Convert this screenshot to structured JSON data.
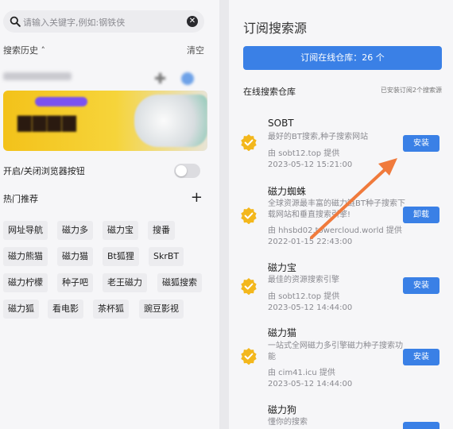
{
  "search": {
    "placeholder": "请输入关键字,例如:钢铁侠",
    "clear_icon": "close-circle-icon"
  },
  "history": {
    "label": "搜索历史 ˄",
    "clear": "清空"
  },
  "browser_toggle": {
    "label": "开启/关闭浏览器按钮"
  },
  "hot": {
    "label": "热门推荐",
    "chips": [
      "网址导航",
      "磁力多",
      "磁力宝",
      "搜番",
      "磁力熊猫",
      "磁力猫",
      "Bt狐狸",
      "SkrBT",
      "磁力柠檬",
      "种子吧",
      "老王磁力",
      "磁狐搜索",
      "磁力狐",
      "看电影",
      "茶杯狐",
      "豌豆影视"
    ]
  },
  "right": {
    "title": "订阅搜索源",
    "subscribe_button": "订阅在线仓库：26 个",
    "repo_label": "在线搜索仓库",
    "installed_note": "已安装订阅2个搜索源",
    "items": [
      {
        "name": "SOBT",
        "desc": "最好的BT搜索,种子搜索网站",
        "provider": "由 sobt12.top 提供",
        "date": "2023-05-12 15:21:00",
        "action": "安装"
      },
      {
        "name": "磁力蜘蛛",
        "desc": "全球资源最丰富的磁力链BT种子搜索下载网站和垂直搜索引擎!",
        "provider": "由 hhsbd02.towercloud.world 提供",
        "date": "2022-01-15 22:43:00",
        "action": "卸载"
      },
      {
        "name": "磁力宝",
        "desc": "最佳的资源搜索引擎",
        "provider": "由 sobt12.top 提供",
        "date": "2023-05-12 14:44:00",
        "action": "安装"
      },
      {
        "name": "磁力猫",
        "desc": "一站式全网磁力多引擎磁力种子搜索功能",
        "provider": "由 cim41.icu 提供",
        "date": "2023-05-12 14:44:00",
        "action": "安装"
      },
      {
        "name": "磁力狗",
        "desc": "懂你的搜索",
        "provider": "",
        "date": "",
        "action": ""
      }
    ]
  },
  "colors": {
    "accent": "#3a80e6",
    "check": "#f3b71c",
    "annotation_arrow": "#f07a3c"
  }
}
